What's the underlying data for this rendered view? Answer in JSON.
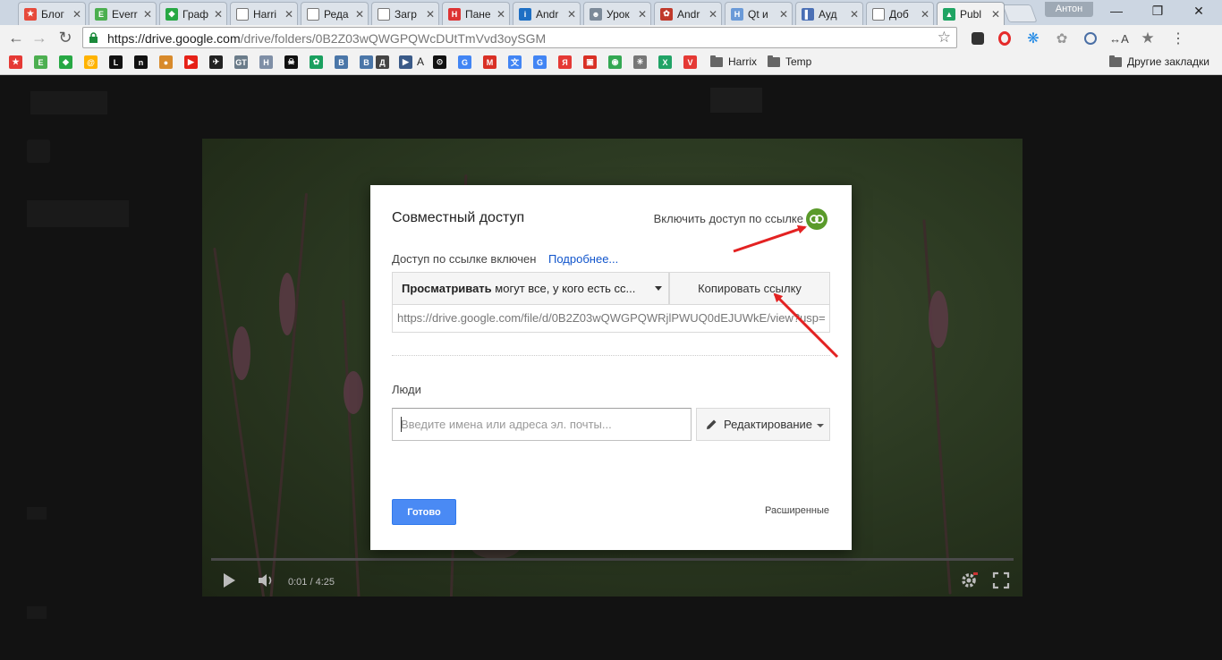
{
  "tabs": [
    {
      "title": "Блог",
      "color": "#e64a3b",
      "glyph": "★"
    },
    {
      "title": "Everr",
      "color": "#4caf50",
      "glyph": "E"
    },
    {
      "title": "Граф",
      "color": "#27a844",
      "glyph": "◆"
    },
    {
      "title": "Harri",
      "color": "#ffffff",
      "glyph": ""
    },
    {
      "title": "Реда",
      "color": "#ffffff",
      "glyph": ""
    },
    {
      "title": "Загр",
      "color": "#ffffff",
      "glyph": ""
    },
    {
      "title": "Пане",
      "color": "#d33",
      "glyph": "H"
    },
    {
      "title": "Andr",
      "color": "#1e6fc4",
      "glyph": "i"
    },
    {
      "title": "Урок",
      "color": "#7c8a99",
      "glyph": "☻"
    },
    {
      "title": "Andr",
      "color": "#c0392b",
      "glyph": "✿"
    },
    {
      "title": "Qt и",
      "color": "#6a9ad8",
      "glyph": "H"
    },
    {
      "title": "Ауд",
      "color": "#4a6fb5",
      "glyph": "▌"
    },
    {
      "title": "Доб",
      "color": "#ffffff",
      "glyph": ""
    },
    {
      "title": "Publ",
      "color": "#1fa463",
      "glyph": "▲",
      "active": true
    }
  ],
  "profile_name": "Антон",
  "window": {
    "minimize": "—",
    "maximize": "❐",
    "close": "✕"
  },
  "toolbar": {
    "url_host": "https://drive.google.com",
    "url_path": "/drive/folders/0B2Z03wQWGPQWcDUtTmVvd3oySGM"
  },
  "bookmarks": {
    "labels": [
      "А",
      "Harrix",
      "Temp"
    ],
    "other_bookmarks": "Другие закладки",
    "icons": [
      {
        "color": "#e53935",
        "glyph": "★"
      },
      {
        "color": "#4caf50",
        "glyph": "E"
      },
      {
        "color": "#27a844",
        "glyph": "◆"
      },
      {
        "color": "#ffb300",
        "glyph": "@"
      },
      {
        "color": "#111111",
        "glyph": "L"
      },
      {
        "color": "#111111",
        "glyph": "n"
      },
      {
        "color": "#d88a2b",
        "glyph": "●"
      },
      {
        "color": "#e62117",
        "glyph": "▶"
      },
      {
        "color": "#222222",
        "glyph": "✈"
      },
      {
        "color": "#6b7c8a",
        "glyph": "GT"
      },
      {
        "color": "#7f8fa6",
        "glyph": "H"
      },
      {
        "color": "#111111",
        "glyph": "☠"
      },
      {
        "color": "#1aa05f",
        "glyph": "✿"
      },
      {
        "color": "#4a76a8",
        "glyph": "B"
      },
      {
        "color": "#4a76a8",
        "glyph": "B"
      },
      {
        "color": "#444444",
        "glyph": "Д"
      },
      {
        "color": "#3a5a88",
        "glyph": "▶"
      },
      {
        "color": "#111111",
        "glyph": "⊙"
      },
      {
        "color": "#4285f4",
        "glyph": "G"
      },
      {
        "color": "#d93025",
        "glyph": "M"
      },
      {
        "color": "#4285f4",
        "glyph": "文"
      },
      {
        "color": "#4285f4",
        "glyph": "G"
      },
      {
        "color": "#e53935",
        "glyph": "Я"
      },
      {
        "color": "#d93025",
        "glyph": "▣"
      },
      {
        "color": "#34a853",
        "glyph": "◉"
      },
      {
        "color": "#777777",
        "glyph": "✳"
      },
      {
        "color": "#21a366",
        "glyph": "X"
      },
      {
        "color": "#e53935",
        "glyph": "V"
      }
    ]
  },
  "video": {
    "time": "0:01 / 4:25"
  },
  "dialog": {
    "title": "Совместный доступ",
    "link_toggle_label": "Включить доступ по ссылке",
    "status_text": "Доступ по ссылке включен",
    "more_link": "Подробнее...",
    "permission_bold": "Просматривать",
    "permission_rest": "могут все, у кого есть сс...",
    "copy_button": "Копировать ссылку",
    "link_url": "https://drive.google.com/file/d/0B2Z03wQWGPQWRjlPWUQ0dEJUWkE/view?usp=",
    "people_label": "Люди",
    "people_placeholder": "Введите имена или адреса эл. почты...",
    "edit_button": "Редактирование",
    "done_button": "Готово",
    "advanced_link": "Расширенные"
  },
  "colors": {
    "accent": "#4a8af4",
    "link": "#1155cc",
    "toggle_on": "#5a9a2b",
    "arrow": "#e32222"
  }
}
